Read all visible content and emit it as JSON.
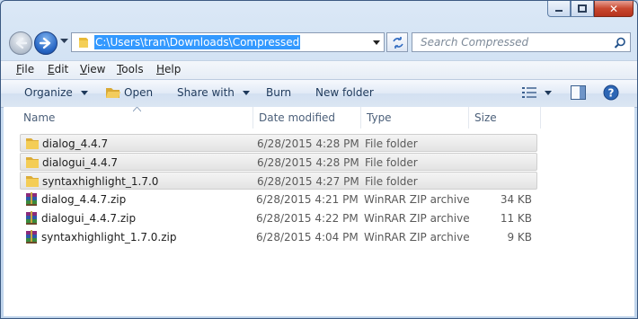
{
  "window": {
    "close_label": "✕"
  },
  "nav": {
    "address_path": "C:\\Users\\tran\\Downloads\\Compressed",
    "search_placeholder": "Search Compressed"
  },
  "menu": [
    {
      "label": "File",
      "key": "F",
      "rest": "ile"
    },
    {
      "label": "Edit",
      "key": "E",
      "rest": "dit"
    },
    {
      "label": "View",
      "key": "V",
      "rest": "iew"
    },
    {
      "label": "Tools",
      "key": "T",
      "rest": "ools"
    },
    {
      "label": "Help",
      "key": "H",
      "rest": "elp"
    }
  ],
  "toolbar": {
    "organize": "Organize",
    "open": "Open",
    "share_with": "Share with",
    "burn": "Burn",
    "new_folder": "New folder"
  },
  "columns": {
    "name": "Name",
    "date_modified": "Date modified",
    "type": "Type",
    "size": "Size"
  },
  "files": [
    {
      "name": "dialog_4.4.7",
      "date": "6/28/2015 4:28 PM",
      "type": "File folder",
      "size": "",
      "icon": "folder-icon",
      "selected": true
    },
    {
      "name": "dialogui_4.4.7",
      "date": "6/28/2015 4:28 PM",
      "type": "File folder",
      "size": "",
      "icon": "folder-icon",
      "selected": true
    },
    {
      "name": "syntaxhighlight_1.7.0",
      "date": "6/28/2015 4:27 PM",
      "type": "File folder",
      "size": "",
      "icon": "folder-icon",
      "selected": true
    },
    {
      "name": "dialog_4.4.7.zip",
      "date": "6/28/2015 4:21 PM",
      "type": "WinRAR ZIP archive",
      "size": "34 KB",
      "icon": "winrar-archive-icon",
      "selected": false
    },
    {
      "name": "dialogui_4.4.7.zip",
      "date": "6/28/2015 4:22 PM",
      "type": "WinRAR ZIP archive",
      "size": "11 KB",
      "icon": "winrar-archive-icon",
      "selected": false
    },
    {
      "name": "syntaxhighlight_1.7.0.zip",
      "date": "6/28/2015 4:04 PM",
      "type": "WinRAR ZIP archive",
      "size": "9 KB",
      "icon": "winrar-archive-icon",
      "selected": false
    }
  ],
  "colors": {
    "selection_blue": "#3399ff",
    "command_text": "#1e395b",
    "close_red": "#c8482f"
  }
}
